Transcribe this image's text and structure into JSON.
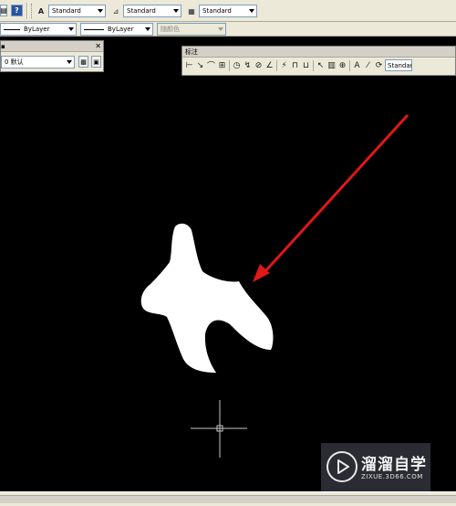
{
  "toolbar_styles": {
    "text_style": "Standard",
    "dim_style": "Standard",
    "table_style": "Standard"
  },
  "toolbar_properties": {
    "linetype": "ByLayer",
    "lineweight": "ByLayer",
    "plot_color": "随颜色"
  },
  "layers_panel": {
    "current_layer": "0 默认"
  },
  "dimension_toolbar": {
    "title": "标注",
    "dim_style": "Standar"
  },
  "colors": {
    "canvas": "#000000",
    "shape_fill": "#ffffff",
    "arrow": "#e01818",
    "crosshair": "#c8c8c8",
    "toolbar": "#ece9d8"
  },
  "watermark": {
    "brand": "溜溜自学",
    "site": "ZIXUE.3D66.COM"
  }
}
